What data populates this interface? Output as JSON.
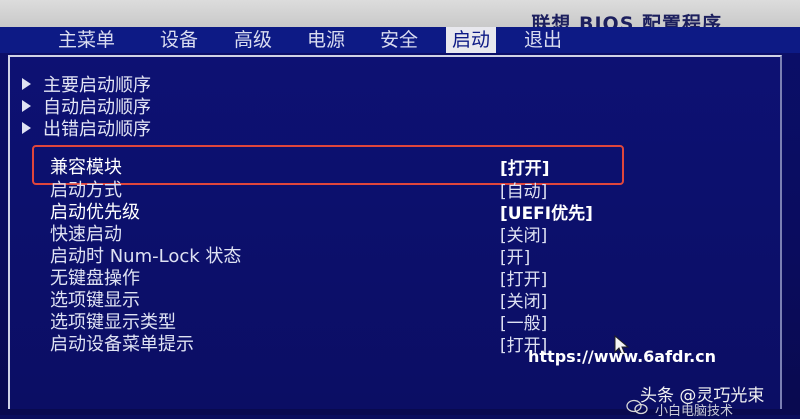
{
  "header": {
    "bios_title": "联想 BIOS 配置程序"
  },
  "tabs": [
    {
      "label": "主菜单",
      "active": false
    },
    {
      "label": "设备",
      "active": false
    },
    {
      "label": "高级",
      "active": false
    },
    {
      "label": "电源",
      "active": false
    },
    {
      "label": "安全",
      "active": false
    },
    {
      "label": "启动",
      "active": true
    },
    {
      "label": "退出",
      "active": false
    }
  ],
  "submenus": [
    {
      "label": "主要启动顺序"
    },
    {
      "label": "自动启动顺序"
    },
    {
      "label": "出错启动顺序"
    }
  ],
  "settings": [
    {
      "label": "兼容模块",
      "value": "[打开]",
      "selected": true
    },
    {
      "label": "启动方式",
      "value": "[自动]",
      "selected": false
    },
    {
      "label": "启动优先级",
      "value": "[UEFI优先]",
      "selected": false,
      "bright": true
    },
    {
      "label": "快速启动",
      "value": "[关闭]",
      "selected": false
    },
    {
      "label": "启动时 Num-Lock 状态",
      "value": "[开]",
      "selected": false
    },
    {
      "label": "无键盘操作",
      "value": "[打开]",
      "selected": false
    },
    {
      "label": "选项键显示",
      "value": "[关闭]",
      "selected": false
    },
    {
      "label": "选项键显示类型",
      "value": "[一般]",
      "selected": false
    },
    {
      "label": "启动设备菜单提示",
      "value": "[打开]",
      "selected": false
    }
  ],
  "watermarks": {
    "url": "https://www.6afdr.cn",
    "author": "头条 @灵巧光束",
    "author_sub": "小白电脑技术"
  },
  "colors": {
    "background": "#0a0d5c",
    "tab_bar": "#0d1a85",
    "title_band": "#cfcfcf",
    "highlight_box": "#e0463c"
  }
}
